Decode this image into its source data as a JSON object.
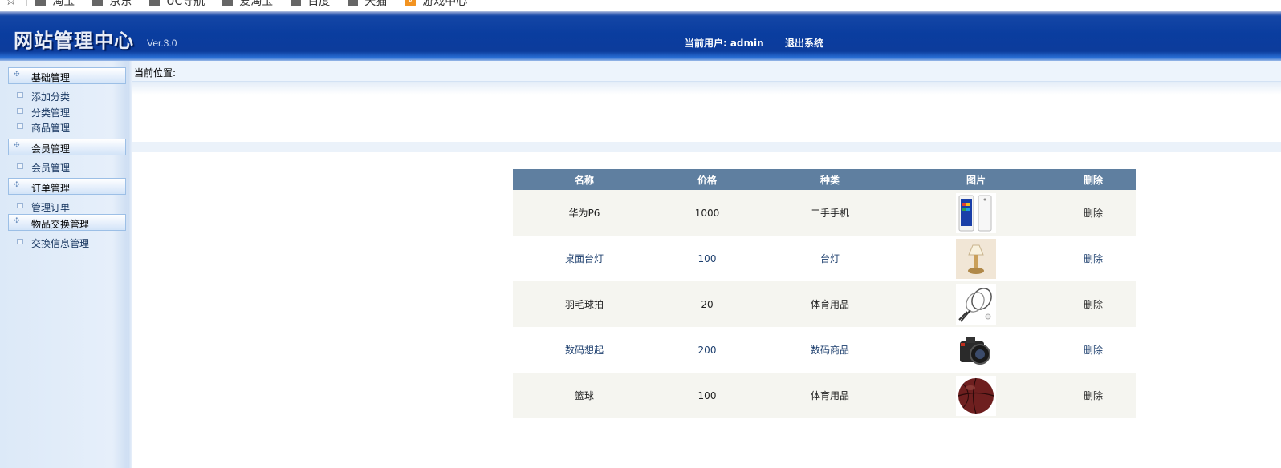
{
  "bookmarks": {
    "items": [
      {
        "label": "淘宝",
        "icon": "folder-icon"
      },
      {
        "label": "京东",
        "icon": "folder-icon"
      },
      {
        "label": "UC导航",
        "icon": "folder-icon"
      },
      {
        "label": "爱淘宝",
        "icon": "folder-icon"
      },
      {
        "label": "百度",
        "icon": "folder-icon"
      },
      {
        "label": "天猫",
        "icon": "folder-icon"
      },
      {
        "label": "游戏中心",
        "icon": "game-icon"
      }
    ]
  },
  "header": {
    "title": "网站管理中心",
    "version": "Ver.3.0",
    "user_label": "当前用户:",
    "username": "admin",
    "logout": "退出系统"
  },
  "sidebar": {
    "groups": [
      {
        "label": "基础管理",
        "items": [
          "添加分类",
          "分类管理",
          "商品管理"
        ]
      },
      {
        "label": "会员管理",
        "items": [
          "会员管理"
        ]
      },
      {
        "label": "订单管理",
        "items": [
          "管理订单"
        ]
      },
      {
        "label": "物品交换管理",
        "items": [
          "交换信息管理"
        ]
      }
    ]
  },
  "main": {
    "location_label": "当前位置:"
  },
  "table": {
    "columns": [
      "名称",
      "价格",
      "种类",
      "图片",
      "删除"
    ],
    "rows": [
      {
        "name": "华为P6",
        "price": "1000",
        "category": "二手手机",
        "image": "phone-image",
        "action": "删除"
      },
      {
        "name": "桌面台灯",
        "price": "100",
        "category": "台灯",
        "image": "lamp-image",
        "action": "删除"
      },
      {
        "name": "羽毛球拍",
        "price": "20",
        "category": "体育用品",
        "image": "racket-image",
        "action": "删除"
      },
      {
        "name": "数码想起",
        "price": "200",
        "category": "数码商品",
        "image": "camera-image",
        "action": "删除"
      },
      {
        "name": "篮球",
        "price": "100",
        "category": "体育用品",
        "image": "ball-image",
        "action": "删除"
      }
    ]
  },
  "colors": {
    "header_blue": "#0a3d9f",
    "table_header": "#5f7fa0",
    "row_alt": "#f5f5f0",
    "link_blue": "#1d3f6e"
  }
}
